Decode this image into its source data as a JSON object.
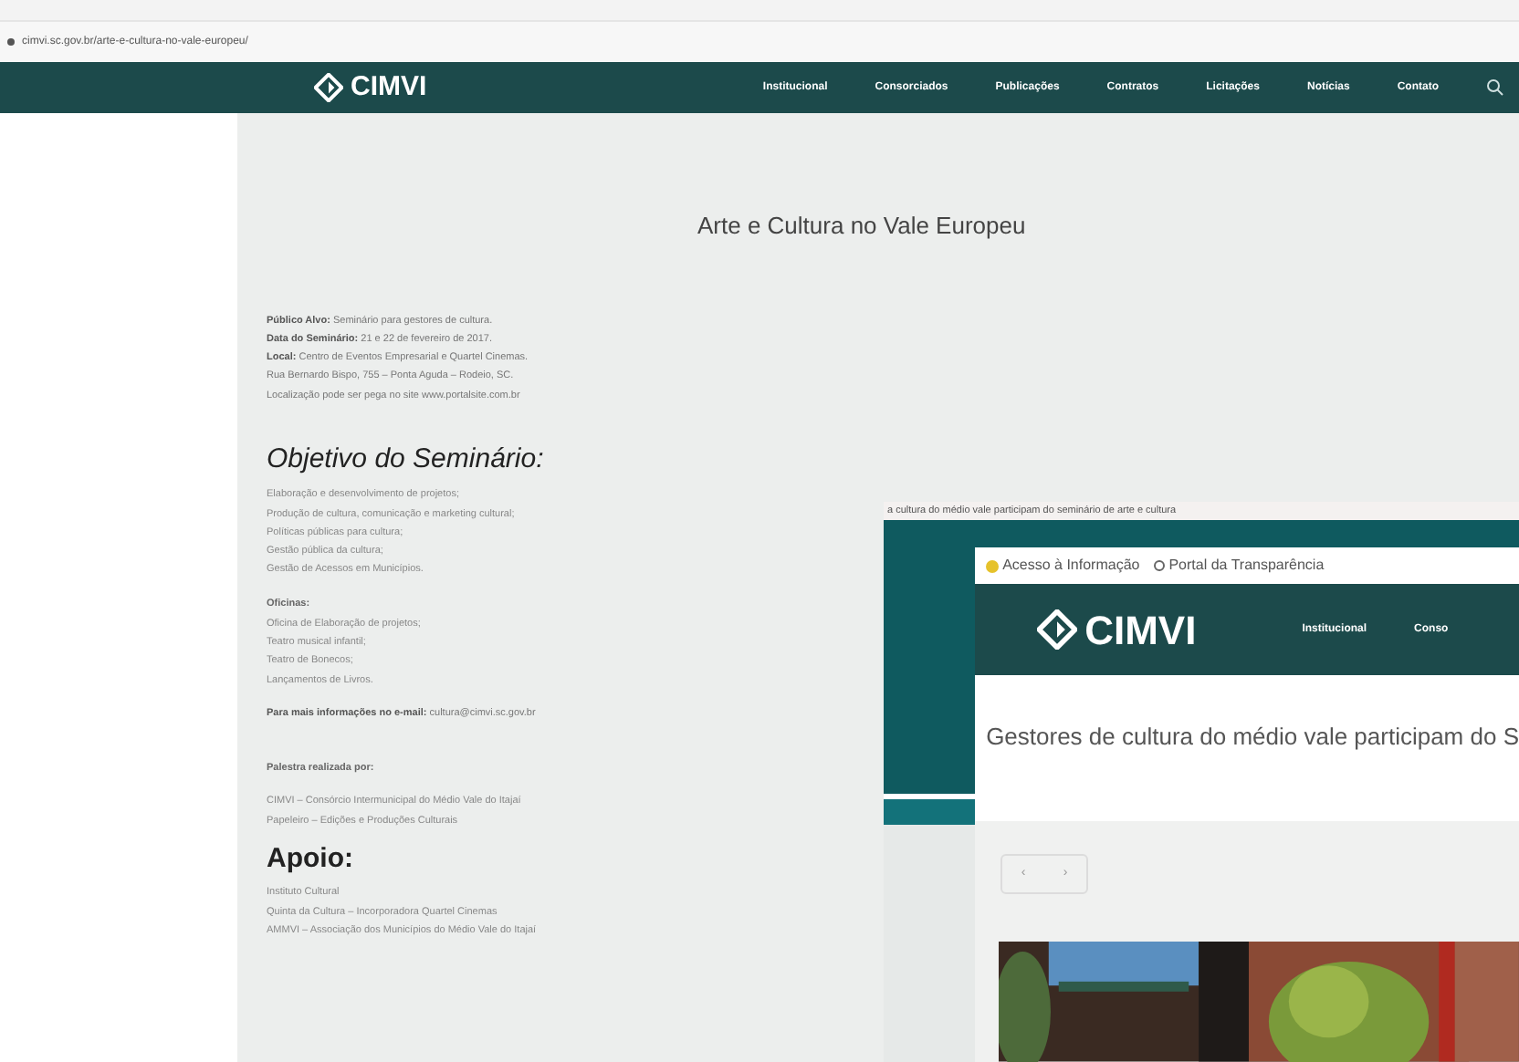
{
  "address_bar": {
    "url": "cimvi.sc.gov.br/arte-e-cultura-no-vale-europeu/"
  },
  "site_header": {
    "logo": "CIMVI",
    "nav": [
      "Institucional",
      "Consorciados",
      "Publicações",
      "Contratos",
      "Licitações",
      "Notícias",
      "Contato"
    ]
  },
  "article": {
    "title": "Arte e Cultura no Vale Europeu",
    "details": [
      {
        "label": "Público Alvo:",
        "text": "Seminário para gestores de cultura."
      },
      {
        "label": "Data do Seminário:",
        "text": "21 e 22 de fevereiro de 2017."
      },
      {
        "label": "Local:",
        "text": "Centro de Eventos Empresarial e Quartel Cinemas."
      },
      {
        "text": "Rua Bernardo Bispo, 755 – Ponta Aguda – Rodeio, SC."
      },
      {
        "text": "Localização pode ser pega no site www.portalsite.com.br"
      }
    ],
    "objective_heading": "Objetivo do Seminário:",
    "objectives": [
      "Elaboração e desenvolvimento de projetos;",
      "Produção de cultura, comunicação e marketing cultural;",
      "Políticas públicas para cultura;",
      "Gestão pública da cultura;",
      "Gestão de Acessos em Municípios."
    ],
    "workshops_heading": "Oficinas:",
    "workshops": [
      "Oficina de Elaboração de projetos;",
      "Teatro musical infantil;",
      "Teatro de Bonecos;",
      "Lançamentos de Livros."
    ],
    "contact": {
      "label": "Para mais informações no e-mail:",
      "email": "cultura@cimvi.sc.gov.br"
    },
    "organizers_heading": "Palestra realizada por:",
    "organizers": [
      "CIMVI – Consórcio Intermunicipal do Médio Vale do Itajaí",
      "Papeleiro – Edições e Produções Culturais"
    ],
    "support_heading": "Apoio:",
    "supporters": [
      "Instituto Cultural",
      "Quinta da Cultura – Incorporadora Quartel Cinemas",
      "AMMVI – Associação dos Municípios do Médio Vale do Itajaí"
    ]
  },
  "overlay": {
    "caption": "a cultura do médio vale participam do seminário de arte e cultura",
    "top_links": [
      "Acesso à Informação",
      "Portal da Transparência"
    ],
    "logo": "CIMVI",
    "nav": [
      "Institucional",
      "Conso"
    ],
    "title": "Gestores de cultura do médio vale participam do S",
    "pager": [
      "‹",
      "›"
    ],
    "photo": {
      "kind": "picture"
    }
  }
}
